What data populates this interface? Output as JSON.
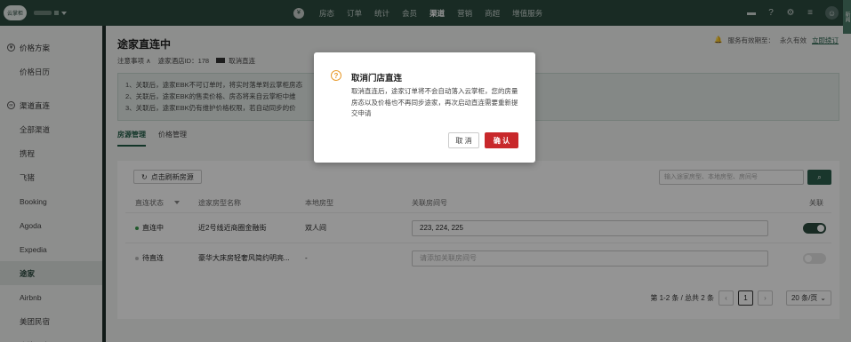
{
  "topbar": {
    "logo_text": "云掌柜",
    "nav_items": [
      "房态",
      "订单",
      "统计",
      "会员",
      "渠道",
      "营销",
      "商超",
      "增值服务"
    ],
    "active_nav": "渠道",
    "news_tab": "新闻"
  },
  "sidebar": {
    "group1": "价格方案",
    "group1_items": [
      "价格日历"
    ],
    "group2": "渠道直连",
    "group2_items": [
      "全部渠道",
      "携程",
      "飞猪",
      "Booking",
      "Agoda",
      "Expedia",
      "途家",
      "Airbnb",
      "美团民宿",
      "小猪民宿"
    ],
    "active_item": "途家"
  },
  "page": {
    "title": "途家直连中",
    "notes_label": "注意事项 ∧",
    "hotel_id_label": "途家酒店ID：178",
    "cancel_link": "取消直连",
    "service_label": "服务有效期至：",
    "service_value": "永久有效",
    "renew_link": "立即续订",
    "notice_lines": [
      "1、关联后，途家EBK不可订单时，将实时落单到云掌柜房态",
      "2、关联后，途家EBK的售卖价格、房态将来自云掌柜中维",
      "3、关联后，途家EBK仍有维护价格权限，若自动同步的价"
    ],
    "tabs": [
      "房源管理",
      "价格管理"
    ]
  },
  "table": {
    "refresh_label": "点击刷新房源",
    "search_placeholder": "输入途家房型、本地房型、房间号",
    "headers": [
      "直连状态",
      "途家房型名称",
      "本地房型",
      "关联房间号",
      "关联"
    ],
    "rows": [
      {
        "status": "直连中",
        "status_color": "#3a9a4c",
        "name": "近2号线近商圈金融街",
        "local": "双人间",
        "rooms": "223, 224, 225",
        "enabled": true
      },
      {
        "status": "待直连",
        "status_color": "#bbbbbb",
        "name": "豪华大床房轻奢风简约明亮...",
        "local": "-",
        "rooms": "",
        "rooms_placeholder": "请添加关联房间号",
        "enabled": false
      }
    ],
    "pager_summary": "第 1-2 条 / 总共 2 条",
    "current_page": "1",
    "page_size": "20 条/页"
  },
  "dialog": {
    "title": "取消门店直连",
    "body": "取消直连后，途家订单将不会自动落入云掌柜，您的房量房态以及价格也不再同步途家，再次启动直连需要重新提交申请",
    "cancel_label": "取 消",
    "ok_label": "确 认"
  },
  "colors": {
    "topbar": "#2b4a3f",
    "accent": "#1f5c45",
    "danger": "#c8282b",
    "warning": "#e89a2c"
  }
}
